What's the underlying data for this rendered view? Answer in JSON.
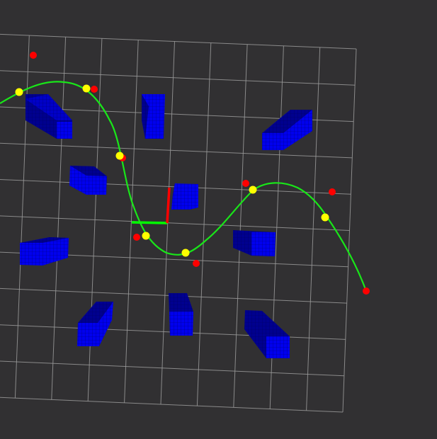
{
  "scene": {
    "background": "#313032",
    "grid_color": "#9a9a9a",
    "obstacle_color": "#0000ee",
    "obstacle_dark": "#00008f",
    "obstacle_mesh": "#000070",
    "path_color": "#19e619",
    "waypoint_color": "#ffff00",
    "target_color": "#ff0000",
    "axis_x_color": "#00ff00",
    "axis_y_color": "#ff0000"
  },
  "icons": {
    "axes": "origin-axes-icon",
    "waypoint": "waypoint-marker",
    "target": "target-marker"
  }
}
